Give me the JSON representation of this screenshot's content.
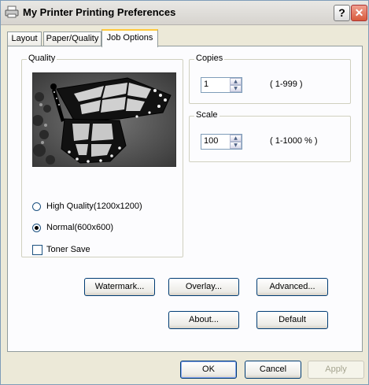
{
  "window": {
    "title": "My Printer Printing Preferences",
    "help_label": "?",
    "close_label": "✕"
  },
  "tabs": [
    {
      "label": "Layout"
    },
    {
      "label": "Paper/Quality"
    },
    {
      "label": "Job Options",
      "active": true
    }
  ],
  "quality": {
    "legend": "Quality",
    "preview_image": "monarch-butterfly",
    "options": [
      {
        "label": "High Quality(1200x1200)",
        "selected": false
      },
      {
        "label": "Normal(600x600)",
        "selected": true
      }
    ],
    "toner_save": {
      "label": "Toner Save",
      "checked": false
    }
  },
  "copies": {
    "legend": "Copies",
    "value": "1",
    "range": "( 1-999 )"
  },
  "scale": {
    "legend": "Scale",
    "value": "100",
    "range": "( 1-1000 % )"
  },
  "buttons": {
    "watermark": "Watermark...",
    "overlay": "Overlay...",
    "advanced": "Advanced...",
    "about": "About...",
    "default": "Default"
  },
  "footer": {
    "ok": "OK",
    "cancel": "Cancel",
    "apply": "Apply"
  }
}
